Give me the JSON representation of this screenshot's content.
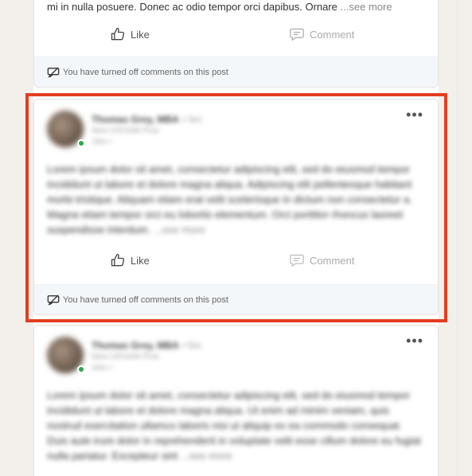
{
  "posts": [
    {
      "text": "mi in nulla posuere. Donec ac odio tempor orci dapibus. Ornare",
      "see_more": "...see more",
      "like_label": "Like",
      "comment_label": "Comment",
      "comments_off_notice": "You have turned off comments on this post"
    },
    {
      "author": "Thomas Grey, MBA",
      "age": "• 5m",
      "subtitle": "New UX/UI/AI Pros",
      "meta": "10m •",
      "text": "Lorem ipsum dolor sit amet, consectetur adipiscing elit, sed do eiusmod tempor incididunt ut labore et dolore magna aliqua. Adipiscing elit pellentesque habitant morbi tristique. Aliquam etiam erat velit scelerisque in dictum non consectetur a. Magna etiam tempor orci eu lobortis elementum. Orci porttitor rhoncus laoreet suspendisse interdum.",
      "see_more": "...see more",
      "like_label": "Like",
      "comment_label": "Comment",
      "comments_off_notice": "You have turned off comments on this post"
    },
    {
      "author": "Thomas Grey, MBA",
      "age": "• 5m",
      "subtitle": "New UX/UI/AI Pros",
      "meta": "10m •",
      "text": "Lorem ipsum dolor sit amet, consectetur adipiscing elit, sed do eiusmod tempor incididunt ut labore et dolore magna aliqua. Ut enim ad minim veniam, quis nostrud exercitation ullamco laboris nisi ut aliquip ex ea commodo consequat. Duis aute irure dolor in reprehenderit in voluptate velit esse cillum dolore eu fugiat nulla pariatur. Excepteur sint",
      "see_more": "...see more"
    }
  ],
  "colors": {
    "highlight": "#e43d20",
    "presence": "#2fa84f",
    "notice_bg": "#f4f7f9"
  }
}
